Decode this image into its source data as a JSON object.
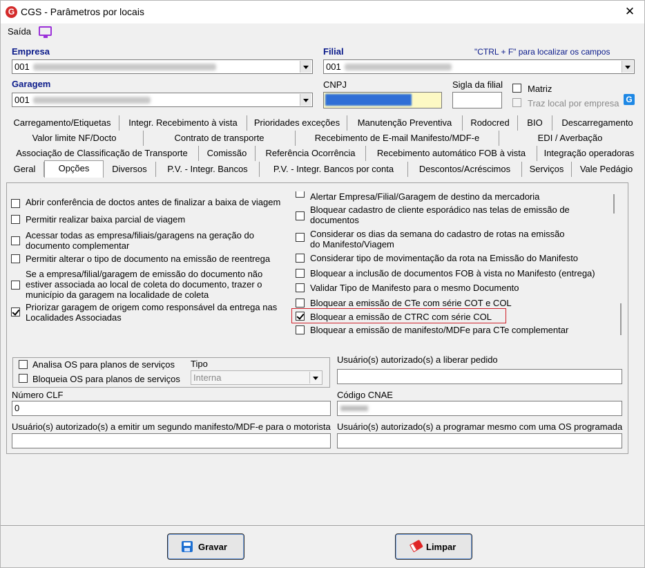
{
  "window": {
    "title": "CGS - Parâmetros por locais",
    "close": "✕",
    "logo": "G"
  },
  "toolbar": {
    "saida": "Saída"
  },
  "fields": {
    "empresa_label": "Empresa",
    "empresa_value": "001",
    "filial_label": "Filial",
    "filial_value": "001",
    "hint": "\"CTRL + F\" para localizar os campos",
    "garagem_label": "Garagem",
    "garagem_value": "001",
    "cnpj_label": "CNPJ",
    "sigla_label": "Sigla da filial",
    "matriz_label": "Matriz",
    "traz_local_label": "Traz local por empresa"
  },
  "tabs": {
    "row1": [
      "Carregamento/Etiquetas",
      "Integr. Recebimento à vista",
      "Prioridades exceções",
      "Manutenção Preventiva",
      "Rodocred",
      "BIO",
      "Descarregamento"
    ],
    "row2": [
      "Valor limite NF/Docto",
      "Contrato de transporte",
      "Recebimento de E-mail Manifesto/MDF-e",
      "EDI / Averbação"
    ],
    "row3": [
      "Associação de Classificação de Transporte",
      "Comissão",
      "Referência Ocorrência",
      "Recebimento automático FOB à vista",
      "Integração operadoras"
    ],
    "row4": [
      "Geral",
      "Opções",
      "Diversos",
      "P.V. - Integr. Bancos",
      "P.V. - Integr. Bancos por conta",
      "Descontos/Acréscimos",
      "Serviços",
      "Vale Pedágio"
    ]
  },
  "left_options": [
    {
      "text": "Abrir conferência de doctos antes de finalizar a baixa de viagem",
      "checked": false
    },
    {
      "text": "Permitir realizar baixa parcial de viagem",
      "checked": false
    },
    {
      "text": "Acessar todas as empresa/filiais/garagens na geração do documento complementar",
      "checked": false
    },
    {
      "text": "Permitir alterar o tipo de documento na emissão de reentrega",
      "checked": false
    },
    {
      "text": "Se a empresa/filial/garagem de emissão do documento não estiver associada ao local de coleta do documento, trazer o município da garagem na localidade de coleta",
      "checked": false
    },
    {
      "text": "Priorizar garagem de origem como responsável da entrega nas Localidades Associadas",
      "checked": true
    }
  ],
  "right_options": [
    {
      "text": "Alertar Empresa/Filial/Garagem de destino da mercadoria",
      "checked": false
    },
    {
      "text": "Bloquear cadastro de cliente esporádico nas telas de emissão de documentos",
      "checked": false
    },
    {
      "text": "Considerar os dias da semana do cadastro de rotas na emissão do Manifesto/Viagem",
      "checked": false
    },
    {
      "text": "Considerar tipo de movimentação da rota na Emissão do Manifesto",
      "checked": false
    },
    {
      "text": "Bloquear a inclusão de documentos FOB à vista no Manifesto (entrega)",
      "checked": false
    },
    {
      "text": "Validar Tipo de Manifesto para o mesmo Documento",
      "checked": false
    },
    {
      "text": "Bloquear a emissão de CTe com série COT e COL",
      "checked": false
    },
    {
      "text": "Bloquear a emissão de CTRC com série COL",
      "checked": true
    },
    {
      "text": "Bloquear a emissão de manifesto/MDFe para CTe complementar",
      "checked": false
    }
  ],
  "os": {
    "analisa": "Analisa OS para planos de serviços",
    "bloqueia": "Bloqueia OS para planos de serviços",
    "tipo_label": "Tipo",
    "tipo_value": "Interna"
  },
  "bottom_fields": {
    "usuario_liberar": "Usuário(s) autorizado(s) a liberar pedido",
    "numero_clf": "Número CLF",
    "numero_clf_value": "0",
    "codigo_cnae": "Código CNAE",
    "usuario_segundo": "Usuário(s) autorizado(s) a emitir um segundo manifesto/MDF-e para o motorista",
    "usuario_programar": "Usuário(s) autorizado(s) a programar mesmo com uma OS programada"
  },
  "buttons": {
    "gravar": "Gravar",
    "limpar": "Limpar"
  },
  "colors": {
    "label_blue": "#0a1a8a",
    "highlight_red": "#d0202a",
    "cnpj_fill": "#2f6fd6"
  }
}
